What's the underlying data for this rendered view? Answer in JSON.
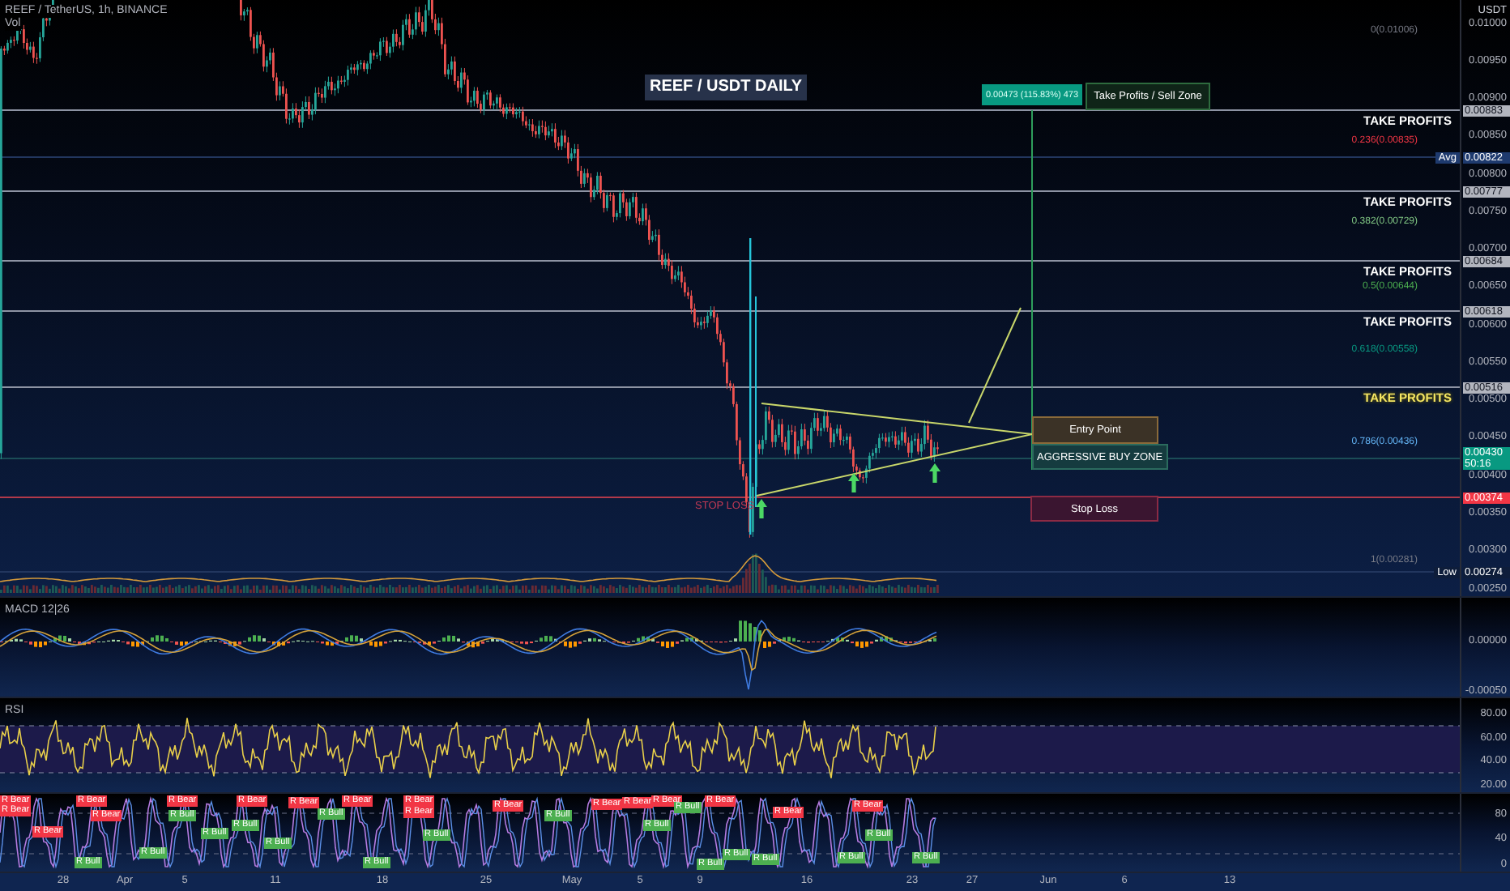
{
  "header": {
    "symbol": "REEF / TetherUS, 1h, BINANCE",
    "volume_label": "Vol"
  },
  "chart_title": "REEF / USDT DAILY",
  "currency": "USDT",
  "price_ticks": [
    "0.01000",
    "0.00950",
    "0.00900",
    "0.00850",
    "0.00800",
    "0.00750",
    "0.00700",
    "0.00650",
    "0.00600",
    "0.00550",
    "0.00500",
    "0.00450",
    "0.00400",
    "0.00350",
    "0.00300",
    "0.00250"
  ],
  "levels": [
    {
      "tag": "0.00883",
      "label": "TAKE PROFITS",
      "highlighted": false
    },
    {
      "tag": "0.00777",
      "label": "TAKE PROFITS",
      "highlighted": false
    },
    {
      "tag": "0.00684",
      "label": "TAKE PROFITS",
      "highlighted": false
    },
    {
      "tag": "0.00618",
      "label": "TAKE PROFITS",
      "highlighted": false
    },
    {
      "tag": "0.00516",
      "label": "TAKE PROFITS",
      "highlighted": true
    }
  ],
  "price_markers": [
    {
      "kind": "average",
      "prefix": "Avg",
      "tag": "0.00822"
    },
    {
      "kind": "last-price",
      "tag": "0.00430",
      "countdown": "50:16"
    },
    {
      "kind": "stop-loss",
      "tag": "0.00374"
    },
    {
      "kind": "low",
      "prefix": "Low",
      "tag": "0.00274"
    }
  ],
  "fib_labels": [
    {
      "text": "0(0.01006)",
      "color": "#787b86"
    },
    {
      "text": "0.236(0.00835)",
      "color": "#f23645"
    },
    {
      "text": "0.382(0.00729)",
      "color": "#81c784"
    },
    {
      "text": "0.5(0.00644)",
      "color": "#4caf50"
    },
    {
      "text": "0.618(0.00558)",
      "color": "#089981"
    },
    {
      "text": "0.786(0.00436)",
      "color": "#64b5f6"
    },
    {
      "text": "1(0.00281)",
      "color": "#787b86"
    }
  ],
  "zones": [
    {
      "kind": "measure",
      "text": "0.00473 (115.83%) 473"
    },
    {
      "kind": "sell-zone",
      "text": "Take Profits / Sell Zone"
    },
    {
      "kind": "entry",
      "text": "Entry Point"
    },
    {
      "kind": "buy-zone",
      "text": "AGGRESSIVE BUY ZONE"
    },
    {
      "kind": "stop-loss",
      "text": "Stop Loss"
    }
  ],
  "stop_loss_text": "STOP LOSS",
  "macd": {
    "label": "MACD 12|26",
    "ticks": [
      "0.00000",
      "-0.00050"
    ]
  },
  "rsi": {
    "label": "RSI",
    "ticks": [
      "80.00",
      "60.00",
      "40.00",
      "20.00"
    ]
  },
  "stoch": {
    "ticks": [
      "80",
      "40",
      "0"
    ],
    "signals": [
      {
        "kind": "bear",
        "text": "R Bear"
      },
      {
        "kind": "bear",
        "text": "R Bear"
      },
      {
        "kind": "bear",
        "text": "R Bear"
      },
      {
        "kind": "bull",
        "text": "R Bull"
      },
      {
        "kind": "bear",
        "text": "R Bear"
      },
      {
        "kind": "bear",
        "text": "R Bear"
      },
      {
        "kind": "bull",
        "text": "R Bull"
      },
      {
        "kind": "bear",
        "text": "R Bear"
      },
      {
        "kind": "bull",
        "text": "R Bull"
      },
      {
        "kind": "bull",
        "text": "R Bull"
      },
      {
        "kind": "bull",
        "text": "R Bull"
      },
      {
        "kind": "bear",
        "text": "R Bear"
      },
      {
        "kind": "bull",
        "text": "R Bull"
      },
      {
        "kind": "bear",
        "text": "R Bear"
      },
      {
        "kind": "bull",
        "text": "R Bull"
      },
      {
        "kind": "bear",
        "text": "R Bear"
      },
      {
        "kind": "bull",
        "text": "R Bull"
      },
      {
        "kind": "bear",
        "text": "R Bear"
      },
      {
        "kind": "bear",
        "text": "R Bear"
      },
      {
        "kind": "bull",
        "text": "R Bull"
      },
      {
        "kind": "bear",
        "text": "R Bear"
      },
      {
        "kind": "bull",
        "text": "R Bull"
      },
      {
        "kind": "bear",
        "text": "R Bear"
      },
      {
        "kind": "bear",
        "text": "R Bear"
      },
      {
        "kind": "bull",
        "text": "R Bull"
      },
      {
        "kind": "bear",
        "text": "R Bear"
      },
      {
        "kind": "bull",
        "text": "R Bull"
      },
      {
        "kind": "bull",
        "text": "R Bull"
      },
      {
        "kind": "bear",
        "text": "R Bear"
      },
      {
        "kind": "bull",
        "text": "R Bull"
      },
      {
        "kind": "bull",
        "text": "R Bull"
      },
      {
        "kind": "bear",
        "text": "R Bear"
      },
      {
        "kind": "bull",
        "text": "R Bull"
      },
      {
        "kind": "bear",
        "text": "R Bear"
      },
      {
        "kind": "bull",
        "text": "R Bull"
      },
      {
        "kind": "bull",
        "text": "R Bull"
      }
    ]
  },
  "time_axis": [
    "28",
    "Apr",
    "5",
    "11",
    "18",
    "25",
    "May",
    "5",
    "9",
    "16",
    "23",
    "27",
    "Jun",
    "6",
    "13"
  ]
}
